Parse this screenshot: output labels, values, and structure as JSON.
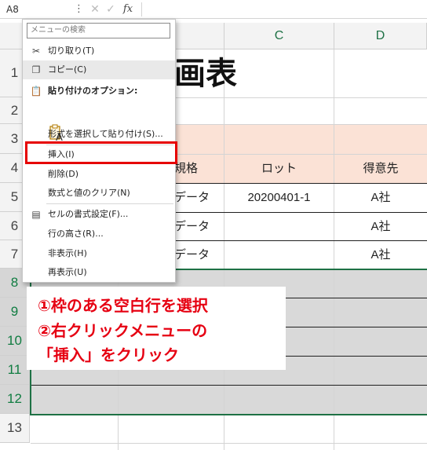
{
  "formula_bar": {
    "name_box": "A8",
    "more": "⋮",
    "cancel": "✕",
    "enter": "✓",
    "fx": "fx",
    "value": ""
  },
  "columns": [
    "C",
    "D"
  ],
  "rows": [
    "1",
    "2",
    "3",
    "4",
    "5",
    "6",
    "7",
    "8",
    "9",
    "10",
    "11",
    "12",
    "13"
  ],
  "sheet": {
    "title_partial": "画表",
    "header_row": {
      "spec": "規格",
      "lot": "ロット",
      "customer": "得意先"
    },
    "data_rows": [
      {
        "spec": "データ",
        "lot": "20200401-1",
        "customer": "A社"
      },
      {
        "spec": "データ",
        "lot": "",
        "customer": "A社"
      },
      {
        "spec": "データ",
        "lot": "",
        "customer": "A社"
      }
    ]
  },
  "context_menu": {
    "search_placeholder": "メニューの検索",
    "items": {
      "cut": "切り取り(T)",
      "copy": "コピー(C)",
      "paste_options": "貼り付けのオプション:",
      "paste_option_glyph": "A",
      "paste_special": "形式を選択して貼り付け(S)...",
      "insert": "挿入(I)",
      "delete": "削除(D)",
      "clear": "数式と値のクリア(N)",
      "format_cells": "セルの書式設定(F)...",
      "row_height": "行の高さ(R)...",
      "hide": "非表示(H)",
      "unhide": "再表示(U)"
    }
  },
  "annotation": {
    "line1": "①枠のある空白行を選択",
    "line2": "②右クリックメニューの",
    "line3": "「挿入」をクリック"
  },
  "colors": {
    "header_fill": "#fbe2d6",
    "selection_fill": "#d9d9d9",
    "highlight_border": "#e60000",
    "annotation_text": "#e60012"
  }
}
